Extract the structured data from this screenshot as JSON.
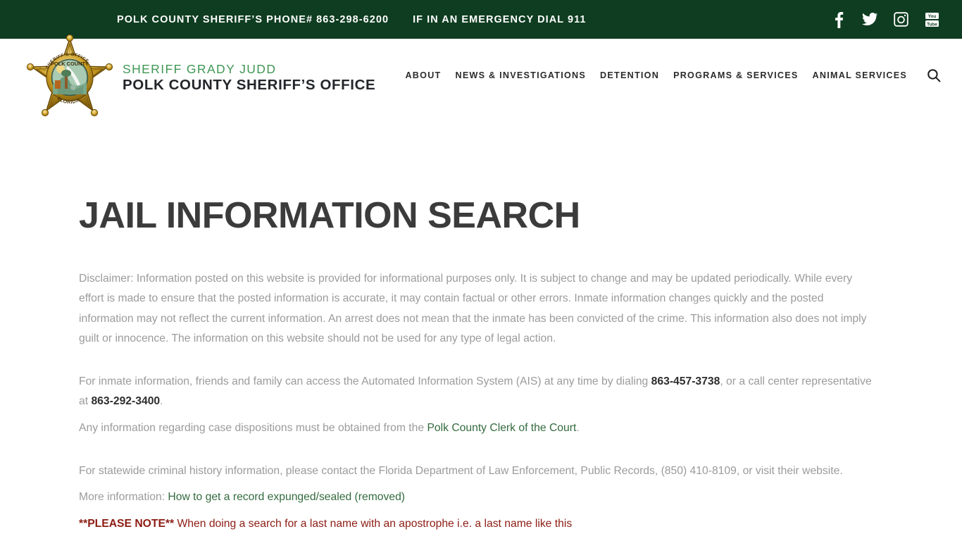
{
  "topbar": {
    "phone_notice": "POLK COUNTY SHERIFF’S PHONE# 863-298-6200",
    "emergency_notice": "IF IN AN EMERGENCY DIAL 911",
    "social": [
      {
        "name": "facebook-icon",
        "label": "Facebook"
      },
      {
        "name": "twitter-icon",
        "label": "Twitter"
      },
      {
        "name": "instagram-icon",
        "label": "Instagram"
      },
      {
        "name": "youtube-icon",
        "label": "YouTube"
      }
    ],
    "background_color": "#0f3d21"
  },
  "header": {
    "badge_alt": "Polk County Sheriff's Office Florida star badge",
    "badge_ring_text_top": "SHERIFF'S OFFICE",
    "badge_ring_text_mid": "POLK COUNTY",
    "badge_ring_text_bottom": "FLORIDA",
    "brand_line_1": "SHERIFF GRADY JUDD",
    "brand_line_2": "POLK COUNTY SHERIFF’S OFFICE",
    "brand_accent_color": "#3f9754",
    "nav": [
      {
        "label": "ABOUT"
      },
      {
        "label": "NEWS & INVESTIGATIONS"
      },
      {
        "label": "DETENTION"
      },
      {
        "label": "PROGRAMS & SERVICES"
      },
      {
        "label": "ANIMAL SERVICES"
      }
    ],
    "search_icon": "search-icon"
  },
  "main": {
    "page_title": "JAIL INFORMATION SEARCH",
    "disclaimer": "Disclaimer: Information posted on this website is provided for informational purposes only. It is subject to change and may be updated periodically. While every effort is made to ensure that the posted information is accurate, it may contain factual or other errors. Inmate information changes quickly and the posted information may not reflect the current information. An arrest does not mean that the inmate has been convicted of the crime. This information also does not imply guilt or innocence.  The information on this website should not be used for any type of legal action.",
    "ais_text_before": "For inmate information, friends and family can access the Automated Information System (AIS) at any time by dialing ",
    "ais_phone": "863-457-3738",
    "ais_text_middle": ", or a call center representative at ",
    "ais_phone_2": "863-292-3400",
    "ais_text_after": ".",
    "clerk_text_before": "Any information regarding case dispositions must be obtained from the ",
    "clerk_link": "Polk County Clerk of the Court",
    "clerk_text_after": ".",
    "fdle_text": "For statewide criminal history information, please contact the Florida Department of Law Enforcement, Public Records, (850) 410-8109, or visit their website.",
    "more_info_label": "More information: ",
    "more_info_link": "How to get a record expunged/sealed (removed)",
    "note_prefix": "**PLEASE NOTE**",
    "note_text": " When doing a search for a last name with an apostrophe i.e. a last name like this",
    "note_color": "#8c1c13",
    "link_color": "#336b3e",
    "body_text_color": "#9b9b9b"
  }
}
